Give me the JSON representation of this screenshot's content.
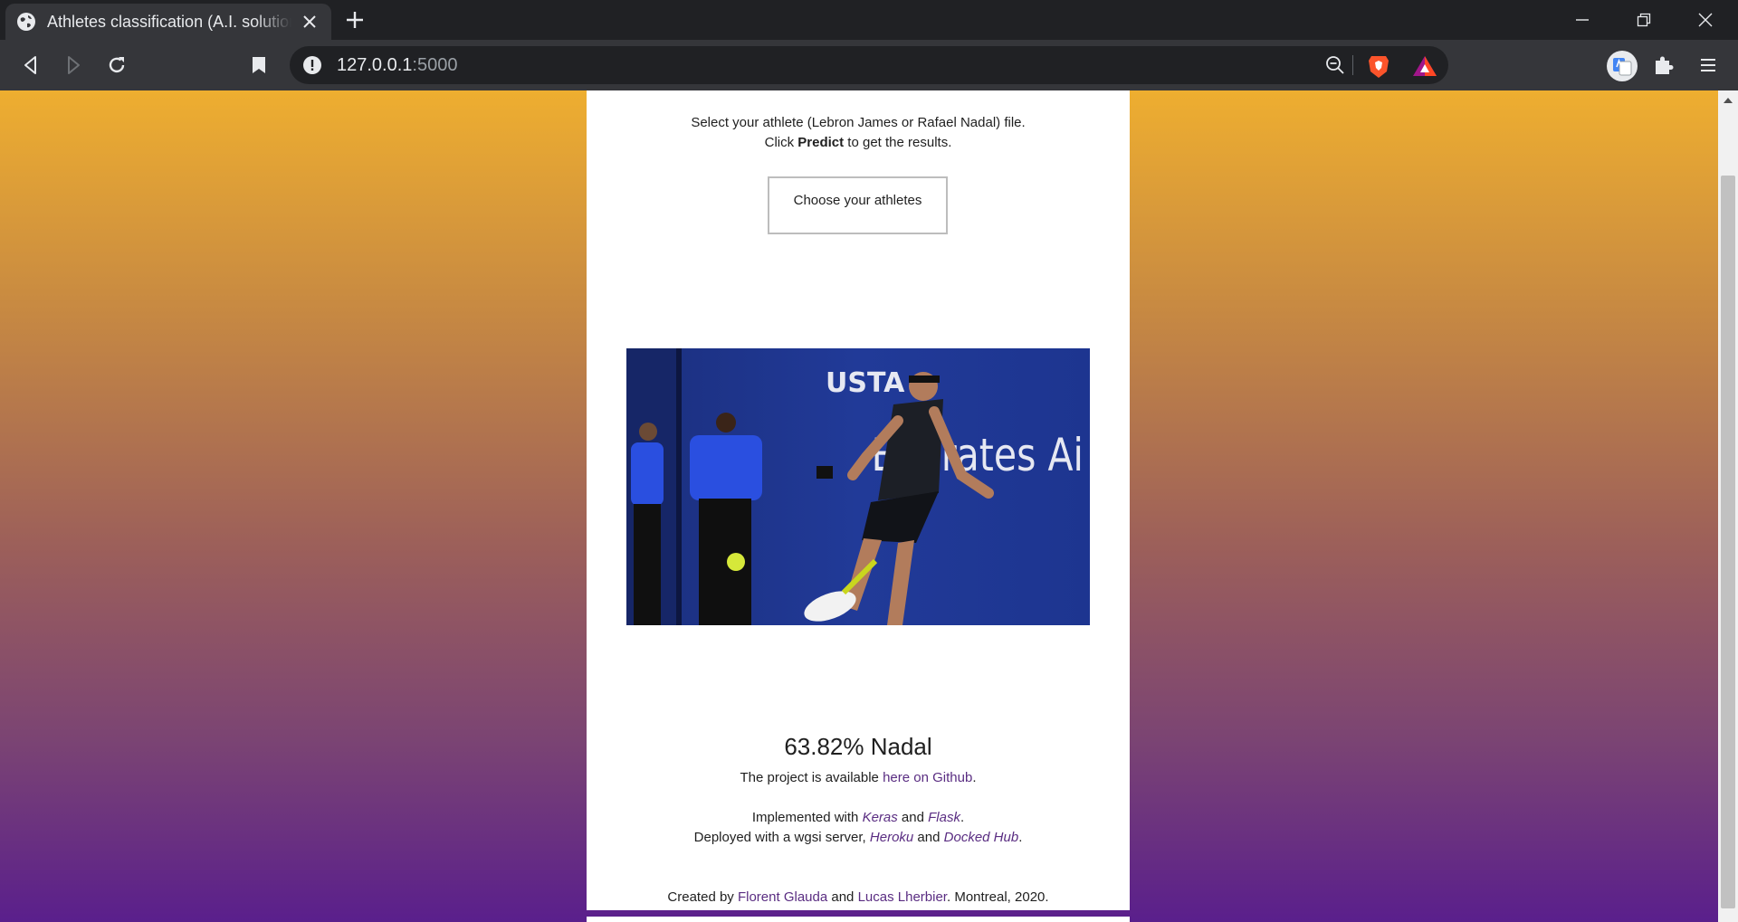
{
  "browser": {
    "tab_title": "Athletes classification (A.I. solution)",
    "url_host": "127.0.0.1",
    "url_port": ":5000"
  },
  "page": {
    "intro_line1": "Select your athlete (Lebron James or Rafael Nadal) file.",
    "intro_click": "Click ",
    "intro_predict": "Predict",
    "intro_rest": " to get the results.",
    "choose_button": "Choose your athletes",
    "photo_alt": "USTA Emirates Ai",
    "photo_banner_usta": "USTA",
    "photo_banner_emirates": "Emirates Ai",
    "result": "63.82% Nadal",
    "github_prefix": "The project is available ",
    "github_link": "here on Github",
    "github_suffix": ".",
    "impl_prefix": "Implemented with ",
    "impl_keras": "Keras",
    "impl_and": " and ",
    "impl_flask": "Flask",
    "impl_suffix": ".",
    "deploy_prefix": "Deployed with a wgsi server, ",
    "deploy_heroku": "Heroku",
    "deploy_and": " and ",
    "deploy_docker": "Docked Hub",
    "deploy_suffix": ".",
    "created_prefix": "Created by ",
    "author1": "Florent Glauda",
    "created_and": " and ",
    "author2": "Lucas Lherbier",
    "created_suffix": ". Montreal, 2020."
  },
  "colors": {
    "gradient_top": "#eeae30",
    "gradient_bottom": "#5a1f8c",
    "link": "#5a2d82"
  },
  "icons": [
    "globe-icon",
    "close-icon",
    "plus-icon",
    "minimize-icon",
    "restore-icon",
    "back-icon",
    "forward-icon",
    "reload-icon",
    "bookmark-icon",
    "info-icon",
    "zoom-out-icon",
    "brave-shield-icon",
    "brave-rewards-icon",
    "translate-icon",
    "extensions-icon",
    "menu-icon"
  ]
}
